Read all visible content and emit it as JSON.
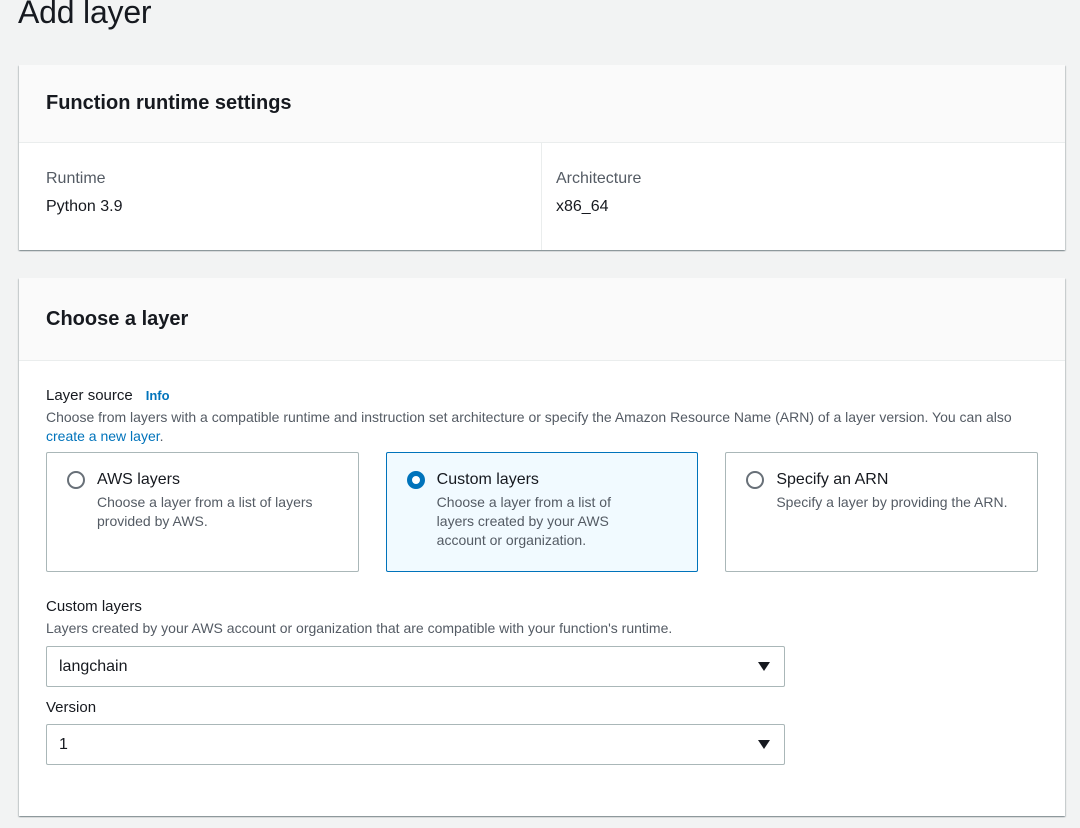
{
  "page": {
    "title": "Add layer"
  },
  "runtime_panel": {
    "title": "Function runtime settings",
    "runtime_label": "Runtime",
    "runtime_value": "Python 3.9",
    "architecture_label": "Architecture",
    "architecture_value": "x86_64"
  },
  "layer_panel": {
    "title": "Choose a layer",
    "source_label": "Layer source",
    "info_label": "Info",
    "source_desc": "Choose from layers with a compatible runtime and instruction set architecture or specify the Amazon Resource Name (ARN) of a layer version. You can also ",
    "create_link": "create a new layer",
    "source_desc_end": ".",
    "options": [
      {
        "title": "AWS layers",
        "desc": "Choose a layer from a list of layers provided by AWS.",
        "selected": false
      },
      {
        "title": "Custom layers",
        "desc": "Choose a layer from a list of layers created by your AWS account or organization.",
        "selected": true
      },
      {
        "title": "Specify an ARN",
        "desc": "Specify a layer by providing the ARN.",
        "selected": false
      }
    ],
    "custom_layers": {
      "label": "Custom layers",
      "desc": "Layers created by your AWS account or organization that are compatible with your function's runtime.",
      "value": "langchain"
    },
    "version": {
      "label": "Version",
      "value": "1"
    }
  },
  "colors": {
    "accent": "#0073bb",
    "selected_bg": "#f1faff"
  }
}
